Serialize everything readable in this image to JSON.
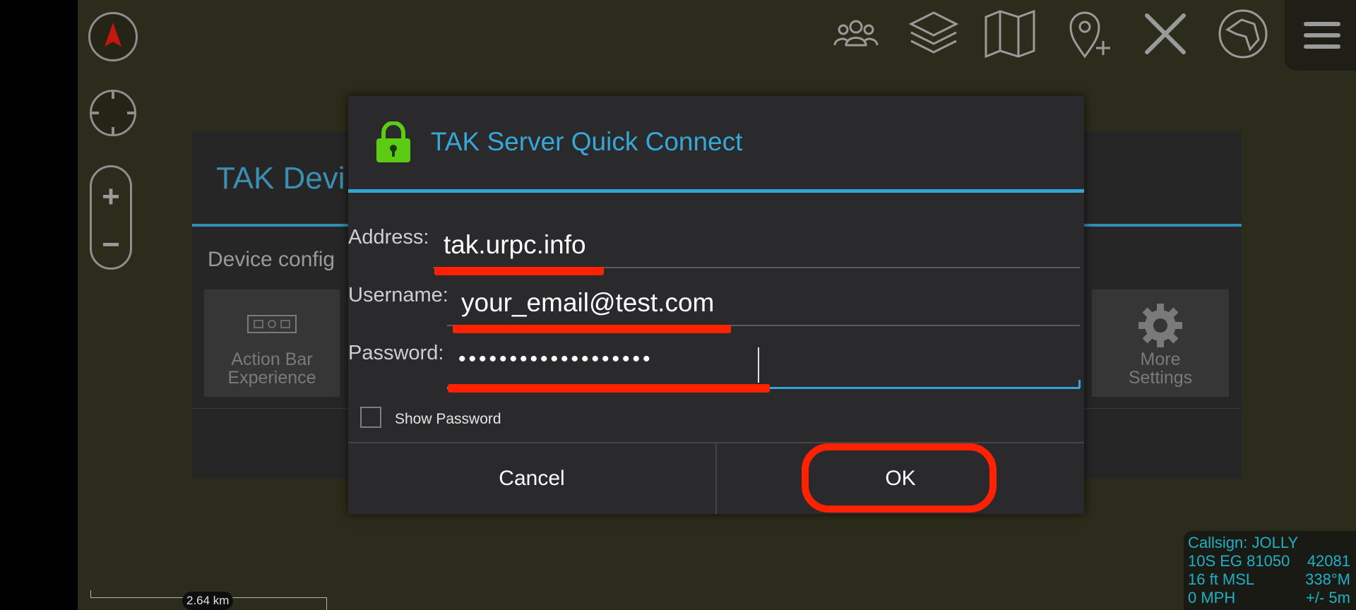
{
  "background_panel": {
    "title": "TAK Devi",
    "subtitle": "Device config",
    "tiles": [
      {
        "label_line1": "Action Bar",
        "label_line2": "Experience"
      },
      {
        "label_line1": "More",
        "label_line2": "Settings"
      }
    ]
  },
  "dialog": {
    "title": "TAK Server Quick Connect",
    "address_label": "Address:",
    "address_value": "tak.urpc.info",
    "username_label": "Username:",
    "username_value": "your_email@test.com",
    "password_label": "Password:",
    "password_masked": "•••••••••••••••••••",
    "show_password_label": "Show Password",
    "cancel_label": "Cancel",
    "ok_label": "OK"
  },
  "status": {
    "callsign": "Callsign: JOLLY",
    "grid": "10S  EG  81050",
    "grid_northing": "42081",
    "altitude": "16 ft MSL",
    "heading": "338°M",
    "speed": "0 MPH",
    "accuracy": "+/- 5m"
  },
  "scale": {
    "label": "2.64 km"
  },
  "icons": [
    "compass-icon",
    "locate-icon",
    "zoom-in-icon",
    "zoom-out-icon",
    "contacts-icon",
    "layers-icon",
    "map-icon",
    "add-point-icon",
    "tools-icon",
    "tak-logo-icon",
    "hamburger-menu-icon",
    "lock-icon",
    "gear-icon",
    "action-bar-icon"
  ],
  "colors": {
    "accent": "#33a6d9",
    "annotation_red": "#ff2200",
    "lock_green": "#5ccb14"
  }
}
